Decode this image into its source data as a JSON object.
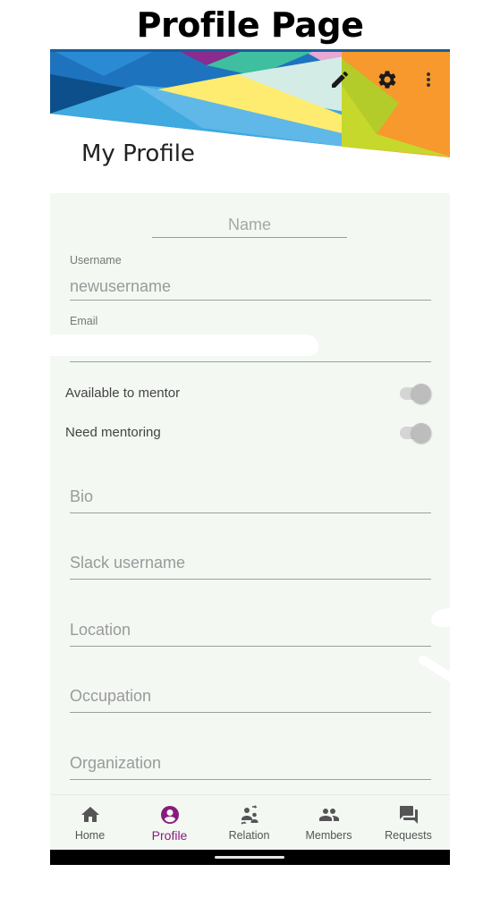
{
  "caption": "Profile Page",
  "screen": {
    "title": "My Profile"
  },
  "toolbar": {
    "icons": [
      "edit-icon",
      "settings-icon",
      "more-vert-icon"
    ]
  },
  "profile": {
    "name_placeholder": "Name",
    "username_label": "Username",
    "username_value": "newusername",
    "email_label": "Email",
    "email_value": ""
  },
  "toggles": [
    {
      "label": "Available to mentor",
      "on": false
    },
    {
      "label": "Need mentoring",
      "on": false
    }
  ],
  "inputs": {
    "bio": "Bio",
    "slack": "Slack username",
    "location": "Location",
    "occupation": "Occupation",
    "organization": "Organization"
  },
  "nav": [
    {
      "label": "Home",
      "icon": "home-icon",
      "active": false
    },
    {
      "label": "Profile",
      "icon": "account-circle-icon",
      "active": true
    },
    {
      "label": "Relation",
      "icon": "relation-icon",
      "active": false
    },
    {
      "label": "Members",
      "icon": "people-icon",
      "active": false
    },
    {
      "label": "Requests",
      "icon": "forum-icon",
      "active": false
    }
  ],
  "colors": {
    "accent": "#8a1a7d",
    "content_bg": "#f3f8f3",
    "header_orange": "#f7992c",
    "header_blue": "#1e73be",
    "header_yellow": "#fdec6f",
    "header_teal": "#3fbf9f",
    "header_lime": "#c6d82c"
  }
}
